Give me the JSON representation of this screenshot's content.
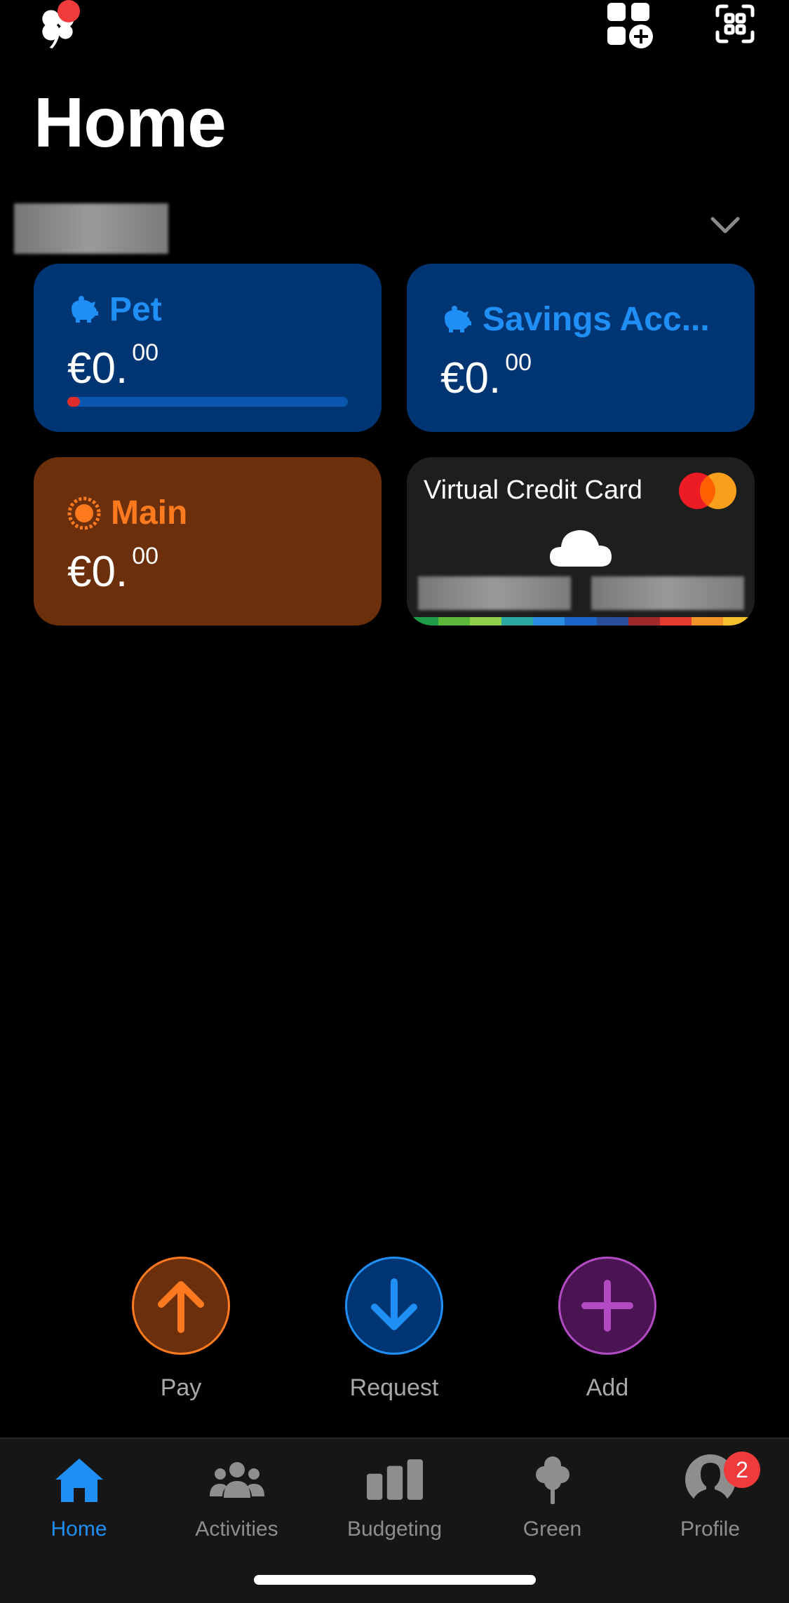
{
  "header": {
    "title": "Home",
    "icons": {
      "logo": "clover-icon",
      "notification_dot_color": "#ef3b3b",
      "add_widget": "apps-add-icon",
      "scan": "scan-icon"
    }
  },
  "account_selector": {
    "chevron": "chevron-down-icon"
  },
  "cards": {
    "pet": {
      "name": "Pet",
      "currency": "€",
      "integer": "0.",
      "decimals": "00",
      "progress_fraction": 0.02,
      "icon": "piggy-bank-icon",
      "color": "#003573"
    },
    "savings": {
      "name": "Savings Acc...",
      "currency": "€",
      "integer": "0.",
      "decimals": "00",
      "icon": "piggy-bank-icon",
      "color": "#003573"
    },
    "main": {
      "name": "Main",
      "currency": "€",
      "integer": "0.",
      "decimals": "00",
      "icon": "coin-icon",
      "color": "#6b300b"
    },
    "virtual_card": {
      "label": "Virtual Credit Card",
      "logo": "mastercard-icon",
      "image": "cloud-icon"
    }
  },
  "actions": [
    {
      "label": "Pay",
      "icon": "arrow-up-icon",
      "color": "#ff7a1e"
    },
    {
      "label": "Request",
      "icon": "arrow-down-icon",
      "color": "#1f8ff5"
    },
    {
      "label": "Add",
      "icon": "plus-icon",
      "color": "#b24ac4"
    }
  ],
  "tabbar": {
    "items": [
      {
        "label": "Home",
        "icon": "home-icon",
        "active": true
      },
      {
        "label": "Activities",
        "icon": "people-icon",
        "active": false
      },
      {
        "label": "Budgeting",
        "icon": "bar-chart-icon",
        "active": false
      },
      {
        "label": "Green",
        "icon": "tree-icon",
        "active": false
      },
      {
        "label": "Profile",
        "icon": "profile-icon",
        "active": false,
        "badge": "2"
      }
    ]
  }
}
